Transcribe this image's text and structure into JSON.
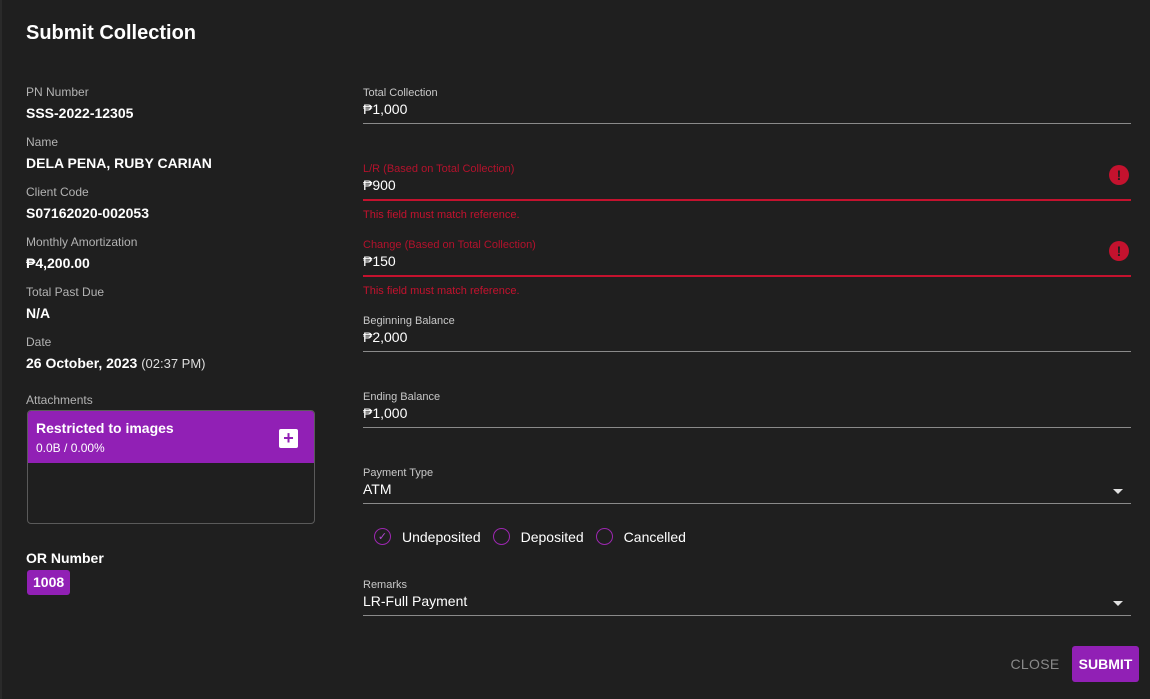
{
  "dialog": {
    "title": "Submit Collection"
  },
  "info": [
    {
      "label": "PN Number",
      "value": "SSS-2022-12305"
    },
    {
      "label": "Name",
      "value": "DELA PENA, RUBY CARIAN"
    },
    {
      "label": "Client Code",
      "value": "S07162020-002053"
    },
    {
      "label": "Monthly Amortization",
      "value": "₱4,200.00"
    },
    {
      "label": "Total Past Due",
      "value": "N/A"
    },
    {
      "label": "Date",
      "value": "26 October, 2023",
      "time": "(02:37 PM)"
    }
  ],
  "attachments": {
    "label": "Attachments",
    "title": "Restricted to images",
    "usage": "0.0B / 0.00%",
    "add_icon": "plus-icon"
  },
  "or_number": {
    "label": "OR Number",
    "value": "1008"
  },
  "fields": {
    "total_collection": {
      "label": "Total Collection",
      "value": "₱1,000"
    },
    "lr": {
      "label": "L/R (Based on Total Collection)",
      "value": "₱900",
      "error": "This field must match reference."
    },
    "change": {
      "label": "Change (Based on Total Collection)",
      "value": "₱150",
      "error": "This field must match reference."
    },
    "beginning_balance": {
      "label": "Beginning Balance",
      "value": "₱2,000"
    },
    "ending_balance": {
      "label": "Ending Balance",
      "value": "₱1,000"
    },
    "payment_type": {
      "label": "Payment Type",
      "value": "ATM"
    },
    "remarks": {
      "label": "Remarks",
      "value": "LR-Full Payment"
    }
  },
  "status_options": [
    {
      "label": "Undeposited",
      "selected": true
    },
    {
      "label": "Deposited",
      "selected": false
    },
    {
      "label": "Cancelled",
      "selected": false
    }
  ],
  "actions": {
    "close_label": "CLOSE",
    "submit_label": "SUBMIT"
  },
  "colors": {
    "accent": "#9120b5",
    "error": "#c4122e",
    "background": "#1f1f1f"
  }
}
